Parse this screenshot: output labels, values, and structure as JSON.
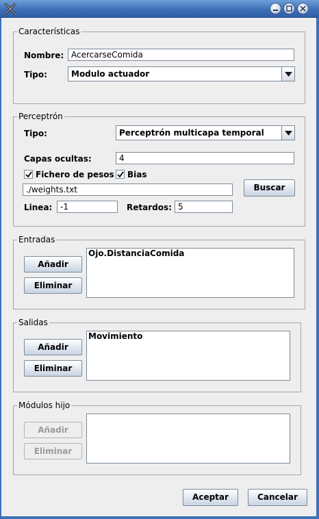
{
  "window": {
    "title": ""
  },
  "caracteristicas": {
    "legend": "Características",
    "nombre_label": "Nombre:",
    "nombre_value": "AcercarseComida",
    "tipo_label": "Tipo:",
    "tipo_value": "Modulo actuador"
  },
  "perceptron": {
    "legend": "Perceptrón",
    "tipo_label": "Tipo:",
    "tipo_value": "Perceptrón multicapa temporal",
    "capas_label": "Capas ocultas:",
    "capas_value": "4",
    "fichero_label": "Fichero de pesos",
    "fichero_checked": true,
    "bias_label": "Bias",
    "bias_checked": true,
    "path_value": "./weights.txt",
    "buscar_label": "Buscar",
    "linea_label": "Linea:",
    "linea_value": "-1",
    "retardos_label": "Retardos:",
    "retardos_value": "5"
  },
  "entradas": {
    "legend": "Entradas",
    "add_label": "Añadir",
    "remove_label": "Eliminar",
    "items": [
      "Ojo.DistanciaComida"
    ]
  },
  "salidas": {
    "legend": "Salidas",
    "add_label": "Añadir",
    "remove_label": "Eliminar",
    "items": [
      "Movimiento"
    ]
  },
  "modulos": {
    "legend": "Módulos hijo",
    "add_label": "Añadir",
    "remove_label": "Eliminar",
    "items": []
  },
  "footer": {
    "accept_label": "Aceptar",
    "cancel_label": "Cancelar"
  },
  "icons": {
    "app": "x-logo-icon",
    "minimize": "minimize-icon",
    "maximize": "maximize-icon",
    "close": "close-icon",
    "dropdown": "chevron-down-icon",
    "check": "checkmark-icon"
  },
  "colors": {
    "titlebar": "#3f70b8",
    "panel": "#eeeeee",
    "border": "#a6a6a6"
  }
}
